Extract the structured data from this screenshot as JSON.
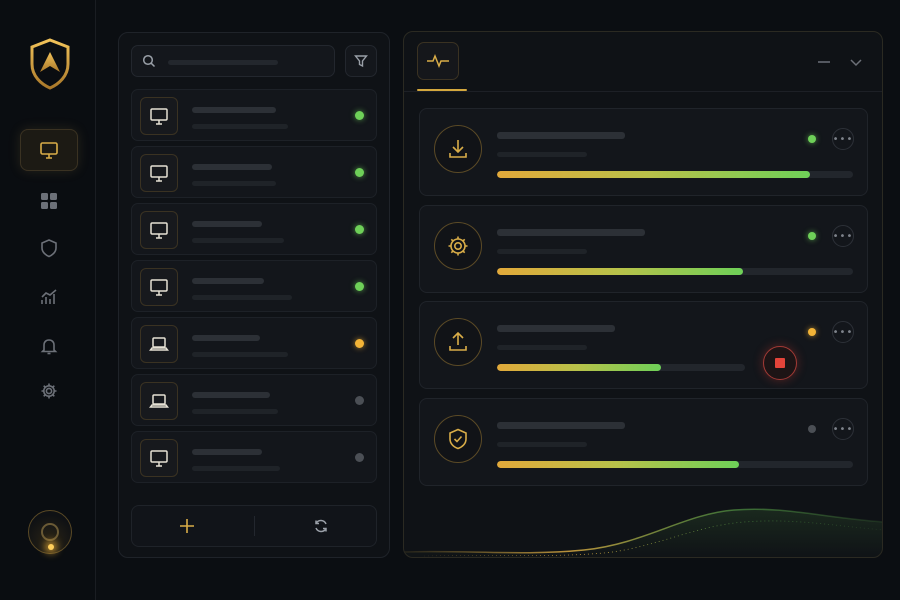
{
  "colors": {
    "accent": "#c9a24a",
    "online": "#6ed058",
    "warning": "#f3b437",
    "offline": "#4b4f55",
    "danger": "#e4443a"
  },
  "rail": {
    "logo_icon": "shield-arrow-icon",
    "active_item": "devices",
    "items": [
      {
        "id": "devices",
        "icon": "monitor-icon"
      },
      {
        "id": "apps",
        "icon": "grid-icon"
      },
      {
        "id": "security",
        "icon": "shield-icon"
      },
      {
        "id": "analytics",
        "icon": "chart-icon"
      },
      {
        "id": "notifications",
        "icon": "bell-icon"
      },
      {
        "id": "settings",
        "icon": "gear-icon"
      }
    ],
    "avatar_icon": "webcam-icon"
  },
  "device_list": {
    "search": {
      "value": "",
      "placeholder": ""
    },
    "filter_icon": "filter-icon",
    "devices": [
      {
        "icon": "monitor-icon",
        "status": "online"
      },
      {
        "icon": "monitor-icon",
        "status": "online"
      },
      {
        "icon": "monitor-icon",
        "status": "online"
      },
      {
        "icon": "monitor-icon",
        "status": "online"
      },
      {
        "icon": "laptop-icon",
        "status": "warning"
      },
      {
        "icon": "laptop-icon",
        "status": "offline"
      },
      {
        "icon": "monitor-icon",
        "status": "offline"
      }
    ],
    "footer": {
      "add_icon": "plus-icon",
      "refresh_icon": "refresh-icon"
    }
  },
  "activity": {
    "tab_icon": "pulse-icon",
    "header_actions": [
      "minimize-icon",
      "chevron-down-icon"
    ],
    "tasks": [
      {
        "icon": "download-icon",
        "status": "online",
        "progress": 0.88,
        "stoppable": false
      },
      {
        "icon": "gear-icon",
        "status": "online",
        "progress": 0.69,
        "stoppable": false
      },
      {
        "icon": "upload-icon",
        "status": "warning",
        "progress": 0.66,
        "stoppable": true
      },
      {
        "icon": "shield-check-icon",
        "status": "offline",
        "progress": 0.68,
        "stoppable": false
      }
    ]
  }
}
